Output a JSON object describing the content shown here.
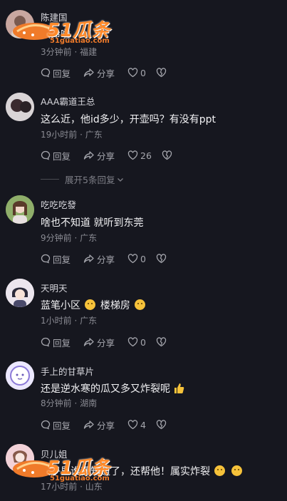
{
  "watermark": {
    "brand": "51瓜条",
    "site": "51guatiao.com"
  },
  "actions": {
    "reply": "回复",
    "share": "分享"
  },
  "comments": [
    {
      "name": "陈建国",
      "text": "救命啦",
      "meta": "3分钟前 · 福建",
      "likes": "0",
      "avatar_color": "#c9a7a0"
    },
    {
      "name": "AAA霸道王总",
      "text": "这么近，他id多少，开壶吗？有没有ppt",
      "meta": "19小时前 · 广东",
      "likes": "26",
      "avatar_color": "#b6b2b8"
    },
    {
      "name": "吃吃吃發",
      "text": "啥也不知道 就听到东莞",
      "meta": "9分钟前 · 广东",
      "likes": "0",
      "avatar_color": "#7a9a5a"
    },
    {
      "name": "天明天",
      "text_a": "蓝笔小区",
      "text_b": "楼梯房",
      "meta": "1小时前 · 广东",
      "likes": "0",
      "avatar_color": "#e8e0e8"
    },
    {
      "name": "手上的甘草片",
      "text": "还是逆水寒的瓜又多又炸裂呢",
      "meta": "8分钟前 · 湖南",
      "likes": "4",
      "avatar_color": "#e9e4ff"
    },
    {
      "name": "贝儿姐",
      "text": "圈子里谁都知道了，还帮他！属实炸裂",
      "meta": "17小时前 · 山东",
      "avatar_color": "#f0c8d0"
    }
  ],
  "expand_replies": "展开5条回复"
}
